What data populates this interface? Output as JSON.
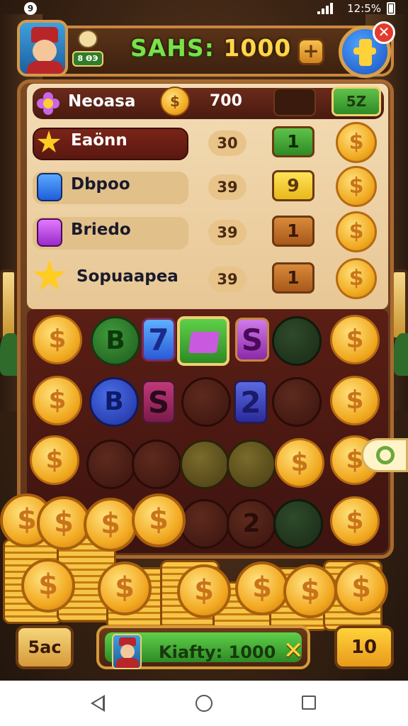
{
  "status_bar": {
    "notification": "9",
    "battery": "12:5%"
  },
  "header": {
    "title_prefix": "SAHS:",
    "title_value": "1000",
    "plus_label": "+",
    "close_label": "✕",
    "badge_label": "8 ӨЭ"
  },
  "list": {
    "rows": [
      {
        "name": "Neoasa",
        "price": "700",
        "action": "5Z"
      },
      {
        "name": "Eaönn",
        "price": "30",
        "qty": "1"
      },
      {
        "name": "Dbpoo",
        "price": "39",
        "qty": "9"
      },
      {
        "name": "Briedo",
        "price": "39",
        "qty": "1"
      },
      {
        "name": "Sopuaapea",
        "price": "39",
        "qty": "1"
      }
    ],
    "coin_symbol": "$"
  },
  "grid": {
    "coin_symbol": "$",
    "tile_7": "7",
    "tile_s": "S",
    "tile_b": "B",
    "tile_2": "2"
  },
  "footer": {
    "left_label": "5ac",
    "center_label": "Kiafty: 1000",
    "x_label": "✕",
    "right_label": "10"
  },
  "icons": {
    "back": "back-icon",
    "home": "home-icon",
    "recents": "recents-icon",
    "signal": "signal-icon",
    "battery": "battery-icon"
  }
}
